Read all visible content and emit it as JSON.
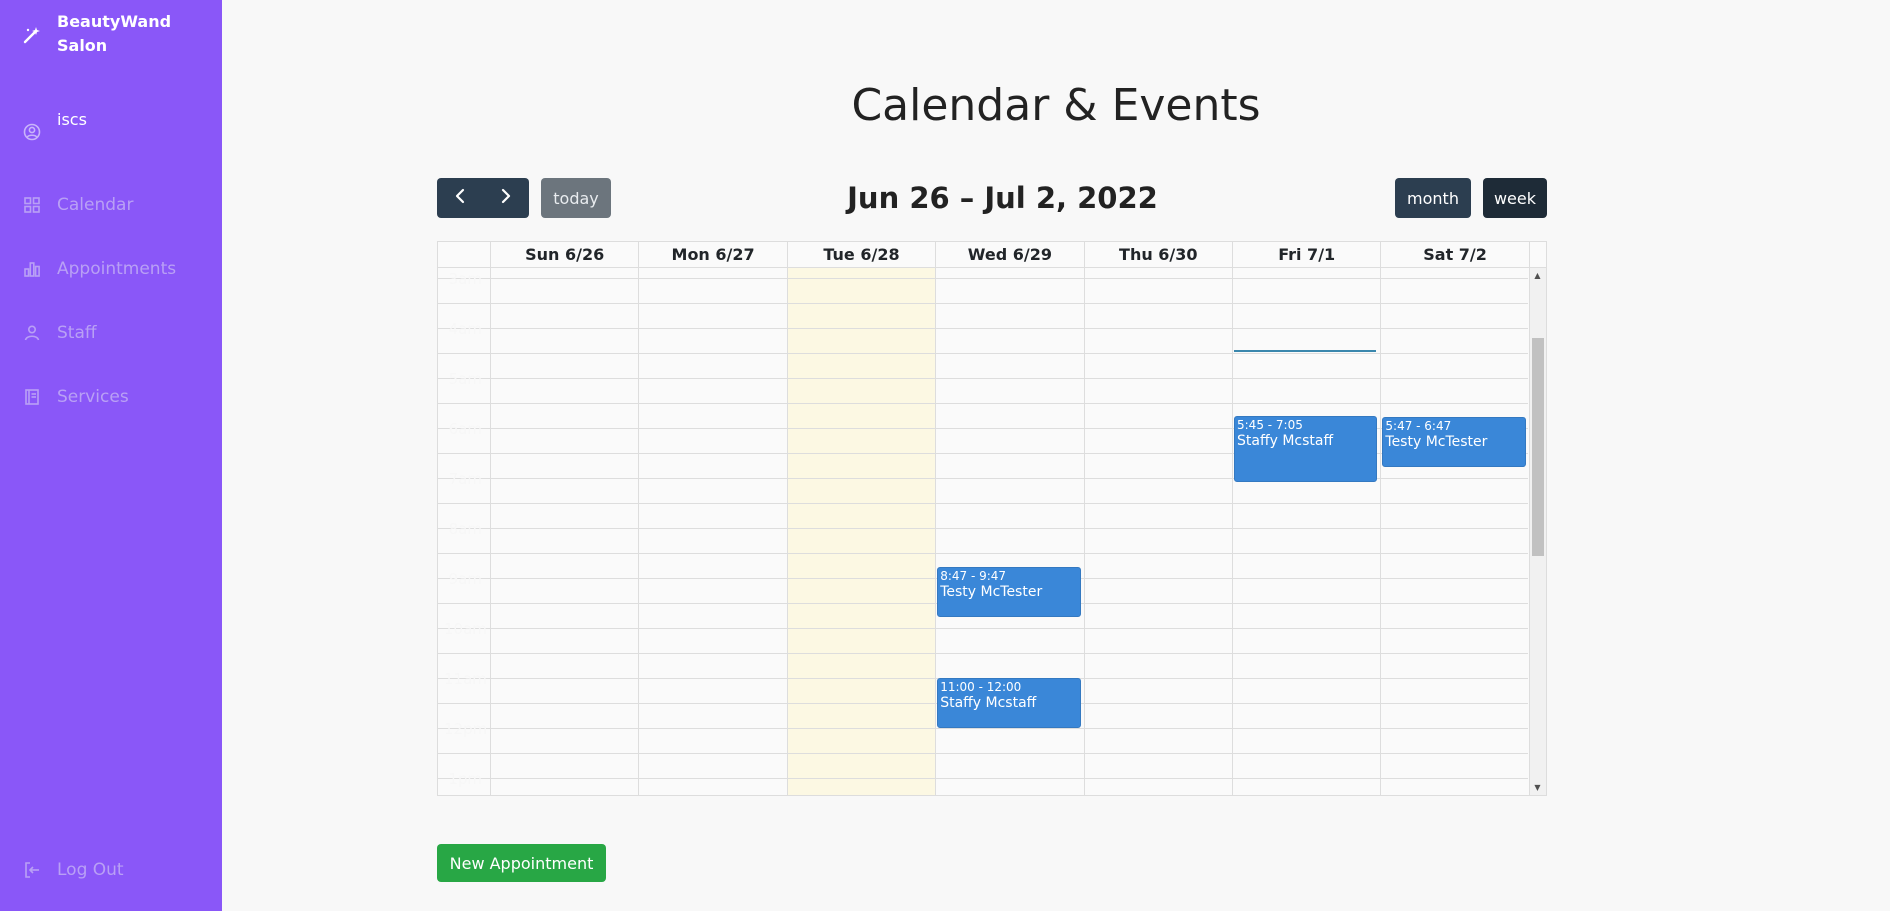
{
  "sidebar": {
    "brand": "BeautyWand Salon",
    "user": "iscs",
    "items": [
      {
        "label": "Calendar",
        "icon": "grid-icon"
      },
      {
        "label": "Appointments",
        "icon": "bar-chart-icon"
      },
      {
        "label": "Staff",
        "icon": "person-icon"
      },
      {
        "label": "Services",
        "icon": "book-icon"
      }
    ],
    "logout": "Log Out"
  },
  "main": {
    "title": "Calendar & Events",
    "range": "Jun 26 – Jul 2, 2022",
    "today_label": "today",
    "month_label": "month",
    "week_label": "week",
    "new_appointment_label": "New Appointment"
  },
  "calendar": {
    "days": [
      "Sun 6/26",
      "Mon 6/27",
      "Tue 6/28",
      "Wed 6/29",
      "Thu 6/30",
      "Fri 7/1",
      "Sat 7/2"
    ],
    "today_day": "Tue 6/28",
    "times": [
      "3am",
      "4am",
      "5am",
      "6am",
      "7am",
      "8am",
      "9am",
      "10am",
      "11am",
      "12pm",
      "1pm"
    ],
    "events": [
      {
        "day": "Fri 7/1",
        "time": "5:45 - 7:05",
        "title": "Staffy Mcstaff"
      },
      {
        "day": "Sat 7/2",
        "time": "5:47 - 6:47",
        "title": "Testy McTester"
      },
      {
        "day": "Wed 6/29",
        "time": "8:47 - 9:47",
        "title": "Testy McTester"
      },
      {
        "day": "Wed 6/29",
        "time": "11:00 - 12:00",
        "title": "Staffy Mcstaff"
      }
    ]
  },
  "colors": {
    "sidebar": "#8a57f8",
    "event": "#3a87d8",
    "today_highlight": "#fcf8e3",
    "new_button": "#28a745"
  }
}
